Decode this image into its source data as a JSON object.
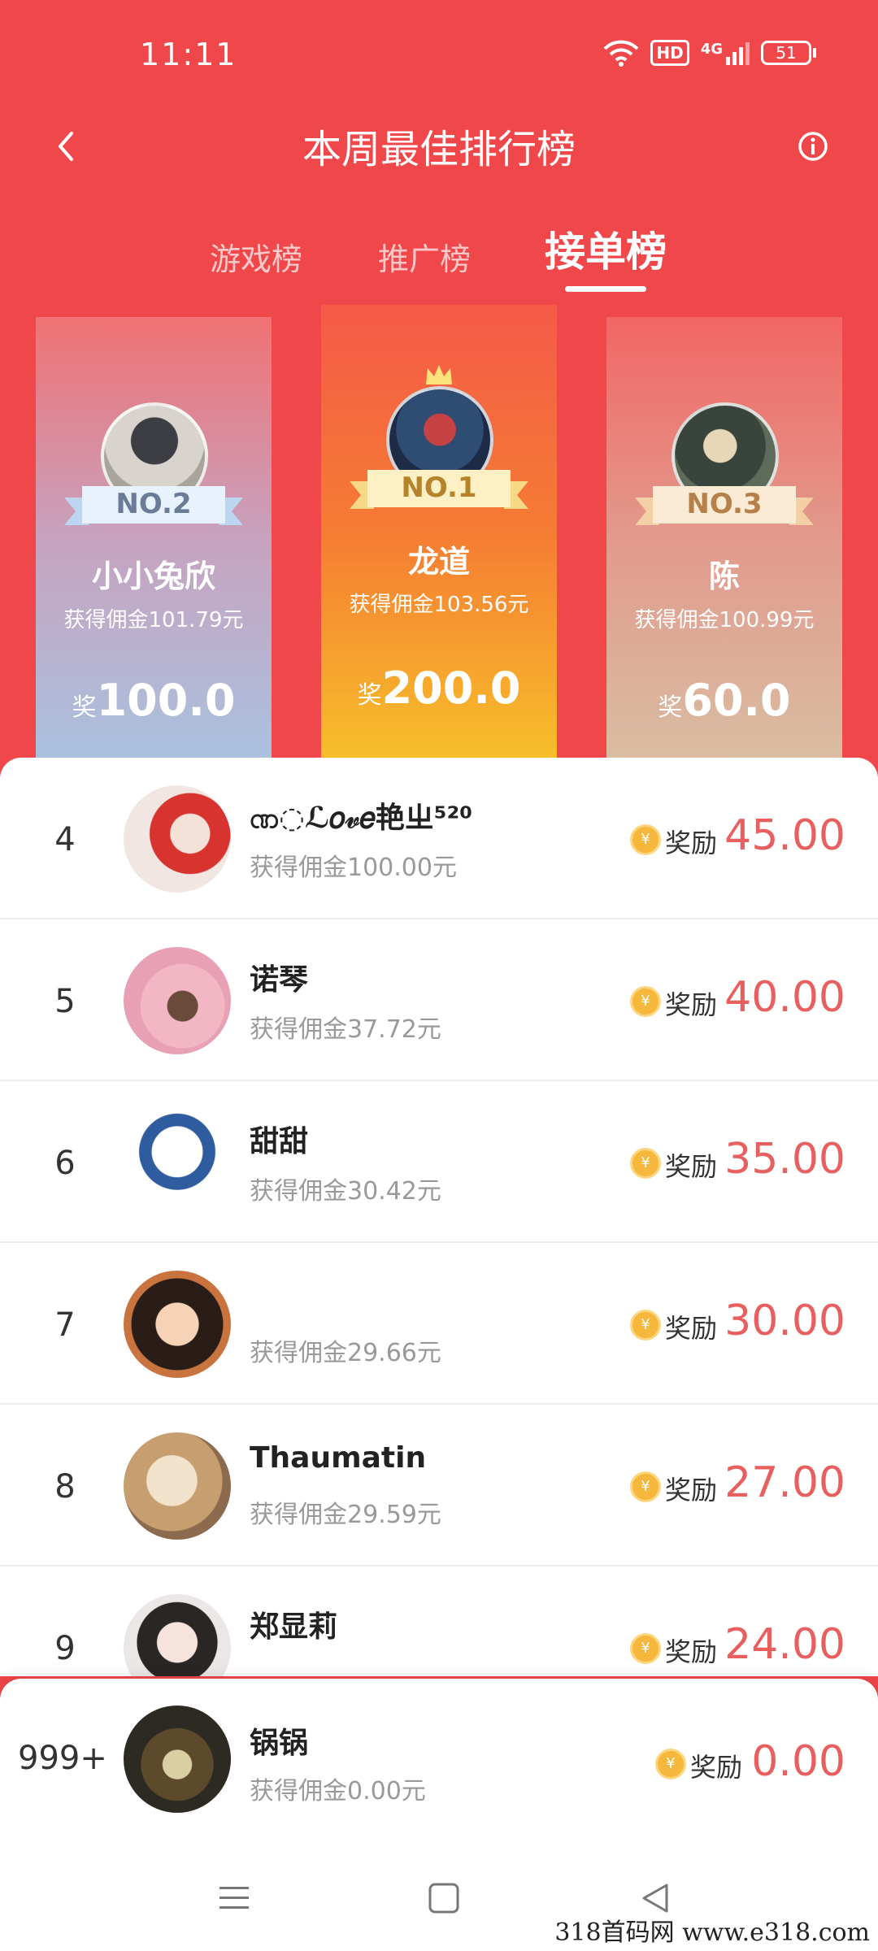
{
  "status_bar": {
    "time": "11:11",
    "hd": "HD",
    "network": "4G",
    "battery": "51"
  },
  "header": {
    "title": "本周最佳排行榜"
  },
  "tabs": [
    {
      "label": "游戏榜",
      "active": false
    },
    {
      "label": "推广榜",
      "active": false
    },
    {
      "label": "接单榜",
      "active": true
    }
  ],
  "podium": {
    "first": {
      "badge": "NO.1",
      "name": "龙道",
      "commission": "获得佣金103.56元",
      "reward_prefix": "奖",
      "reward": "200.0"
    },
    "second": {
      "badge": "NO.2",
      "name": "小小兔欣",
      "commission": "获得佣金101.79元",
      "reward_prefix": "奖",
      "reward": "100.0"
    },
    "third": {
      "badge": "NO.3",
      "name": "陈",
      "commission": "获得佣金100.99元",
      "reward_prefix": "奖",
      "reward": "60.0"
    }
  },
  "list": [
    {
      "rank": "4",
      "name": "ဏ◌ℒ𝑜𝓋𝑒艳ㄓ⁵²⁰",
      "commission": "获得佣金100.00元",
      "reward_label": "奖励",
      "reward": "45.00"
    },
    {
      "rank": "5",
      "name": "诺琴",
      "commission": "获得佣金37.72元",
      "reward_label": "奖励",
      "reward": "40.00"
    },
    {
      "rank": "6",
      "name": "甜甜",
      "commission": "获得佣金30.42元",
      "reward_label": "奖励",
      "reward": "35.00"
    },
    {
      "rank": "7",
      "name": "",
      "commission": "获得佣金29.66元",
      "reward_label": "奖励",
      "reward": "30.00"
    },
    {
      "rank": "8",
      "name": "Thaumatin",
      "commission": "获得佣金29.59元",
      "reward_label": "奖励",
      "reward": "27.00"
    },
    {
      "rank": "9",
      "name": "郑显莉",
      "commission": "",
      "reward_label": "奖励",
      "reward": "24.00"
    }
  ],
  "my_rank": {
    "rank": "999+",
    "name": "锅锅",
    "commission": "获得佣金0.00元",
    "reward_label": "奖励",
    "reward": "0.00"
  },
  "coin_symbol": "¥",
  "watermark": "318首码网  www.e318.com",
  "colors": {
    "primary_red": "#f0474a",
    "reward_red": "#e85f5f",
    "coin": "#f6b73d"
  }
}
